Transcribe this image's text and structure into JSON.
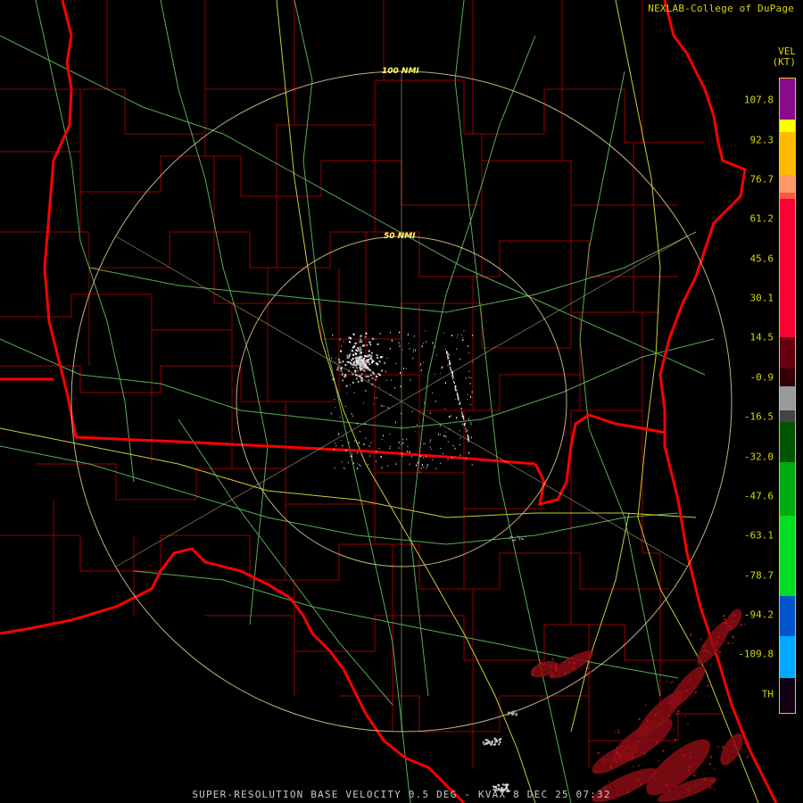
{
  "header": {
    "credit": "NEXLAB-College of DuPage"
  },
  "legend": {
    "title": "VEL",
    "unit": "(KT)",
    "ticks": [
      "107.8",
      "92.3",
      "76.7",
      "61.2",
      "45.6",
      "30.1",
      "14.5",
      "-0.9",
      "-16.5",
      "-32.0",
      "-47.6",
      "-63.1",
      "-78.7",
      "-94.2",
      "-109.8",
      "TH"
    ],
    "colors": {
      "purple": "#8c0a8c",
      "yellow": "#ffff00",
      "salmon": "#ff9966",
      "red": "#ff0033",
      "darkred": "#660011",
      "gray": "#999999",
      "darkgreen": "#005500",
      "green": "#00dd22",
      "blue": "#0055cc",
      "cyan": "#00aaff"
    }
  },
  "map": {
    "rings": [
      {
        "label": "100 NMI"
      },
      {
        "label": "50 NMI"
      }
    ]
  },
  "footer": {
    "text": "SUPER-RESOLUTION BASE VELOCITY 0.5 DEG - KVAX 8 DEC 25 07:32"
  }
}
